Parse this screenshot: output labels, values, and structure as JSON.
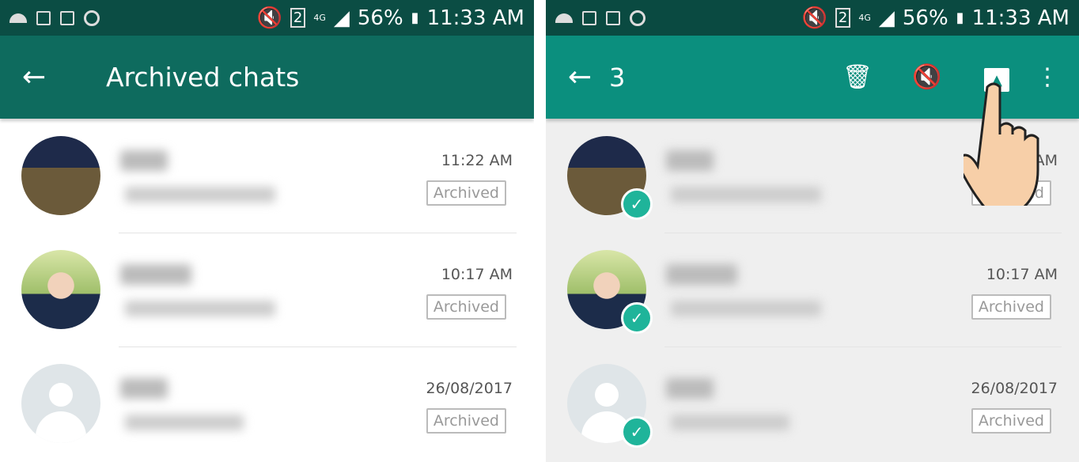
{
  "status_bar": {
    "battery": "56%",
    "time": "11:33 AM",
    "sim": "2",
    "network": "4G"
  },
  "left": {
    "title": "Archived chats",
    "chats": [
      {
        "time": "11:22 AM",
        "badge": "Archived"
      },
      {
        "time": "10:17 AM",
        "badge": "Archived"
      },
      {
        "time": "26/08/2017",
        "badge": "Archived"
      }
    ]
  },
  "right": {
    "selected_count": "3",
    "actions": [
      "delete-icon",
      "mute-icon",
      "unarchive-icon",
      "more-icon"
    ],
    "chats": [
      {
        "time": "11:22 AM",
        "badge": "Archived"
      },
      {
        "time": "10:17 AM",
        "badge": "Archived"
      },
      {
        "time": "26/08/2017",
        "badge": "Archived"
      }
    ]
  },
  "colors": {
    "status_bar": "#0b4d44",
    "toolbar": "#0e6b5e",
    "selection_toolbar": "#0b8f7e",
    "check": "#1fb49a"
  }
}
